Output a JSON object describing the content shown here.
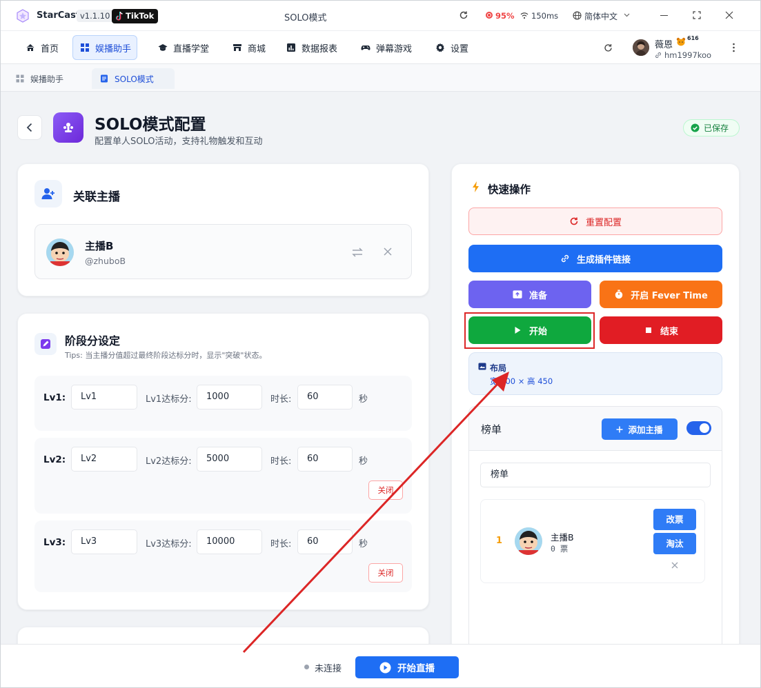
{
  "titlebar": {
    "app_name": "StarCast",
    "version": "v1.1.10",
    "platform": "TikTok",
    "window_title": "SOLO模式",
    "battery": "95%",
    "ping": "150ms",
    "language": "简体中文"
  },
  "nav": {
    "items": [
      {
        "label": "首页",
        "icon": "home-icon"
      },
      {
        "label": "娱播助手",
        "icon": "grid-icon"
      },
      {
        "label": "直播学堂",
        "icon": "graduation-cap-icon"
      },
      {
        "label": "商城",
        "icon": "store-icon"
      },
      {
        "label": "数据报表",
        "icon": "chart-icon"
      },
      {
        "label": "弹幕游戏",
        "icon": "gamepad-icon"
      },
      {
        "label": "设置",
        "icon": "gear-icon"
      }
    ],
    "user": {
      "name": "薇恩",
      "level": "616",
      "handle": "hm1997koo"
    }
  },
  "subtabs": [
    {
      "label": "娱播助手"
    },
    {
      "label": "SOLO模式"
    }
  ],
  "header": {
    "title": "SOLO模式配置",
    "subtitle": "配置单人SOLO活动，支持礼物触发和互动",
    "status": "已保存"
  },
  "anchor_card": {
    "title": "关联主播",
    "anchor_name": "主播B",
    "anchor_handle": "@zhuboB"
  },
  "stage_card": {
    "title": "阶段分设定",
    "tips": "Tips: 当主播分值超过最终阶段达标分时，显示\"突破\"状态。",
    "levels": [
      {
        "label": "Lv1:",
        "name": "Lv1",
        "score_label": "Lv1达标分:",
        "score": "1000",
        "duration_label": "时长:",
        "duration": "60",
        "unit": "秒"
      },
      {
        "label": "Lv2:",
        "name": "Lv2",
        "score_label": "Lv2达标分:",
        "score": "5000",
        "duration_label": "时长:",
        "duration": "60",
        "unit": "秒",
        "close": "关闭"
      },
      {
        "label": "Lv3:",
        "name": "Lv3",
        "score_label": "Lv3达标分:",
        "score": "10000",
        "duration_label": "时长:",
        "duration": "60",
        "unit": "秒",
        "close": "关闭"
      }
    ]
  },
  "quick": {
    "title": "快速操作",
    "reset": "重置配置",
    "plugin_link": "生成插件链接",
    "prepare": "准备",
    "fever": "开启 Fever Time",
    "start": "开始",
    "end": "结束",
    "layout_title": "布局",
    "layout_value": "宽 600 × 高 450"
  },
  "ranking": {
    "title": "榜单",
    "add_button": "添加主播",
    "input_value": "榜单",
    "entries": [
      {
        "rank": "1",
        "name": "主播B",
        "votes": "0 票",
        "edit": "改票",
        "eliminate": "淘汰"
      }
    ]
  },
  "bottom": {
    "status": "未连接",
    "start_live": "开始直播"
  },
  "colors": {
    "primary": "#1e6ef4",
    "green": "#16a34a",
    "red": "#e11d24",
    "orange": "#f97316",
    "purple": "#6d63f0",
    "annotation": "#dc2626"
  }
}
